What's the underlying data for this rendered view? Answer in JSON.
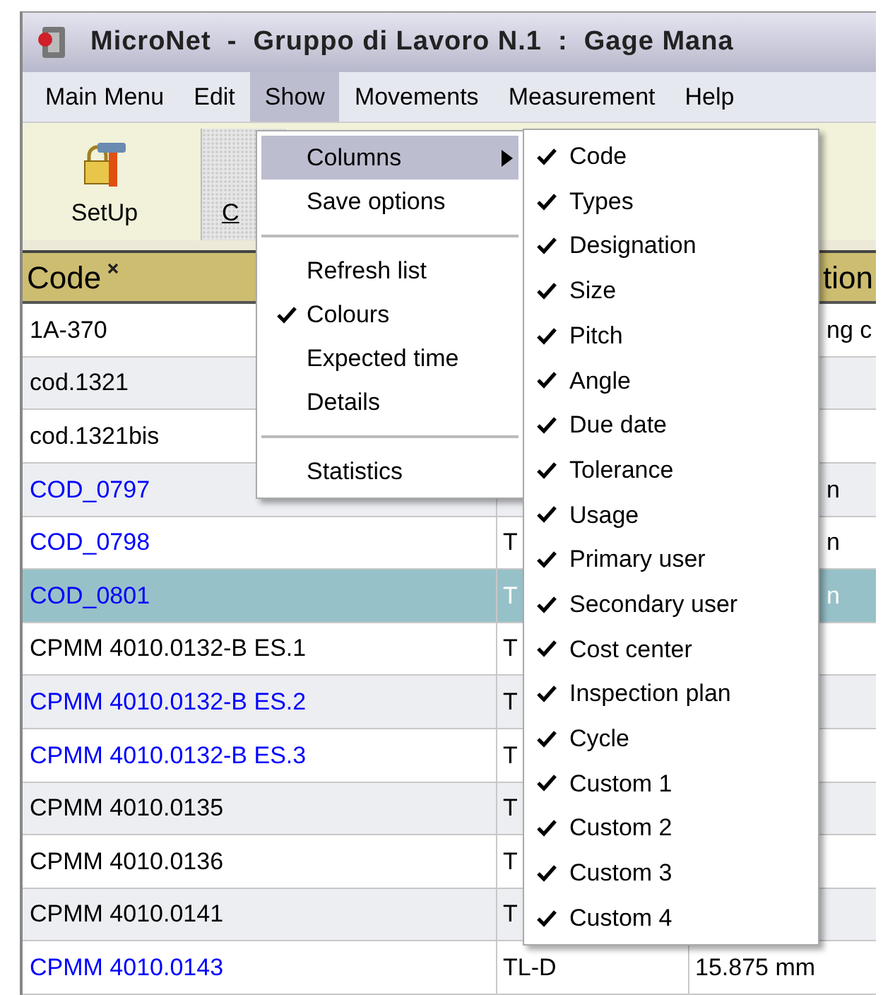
{
  "window": {
    "title": "MicroNet  -  Gruppo di Lavoro N.1  :  Gage Mana"
  },
  "menu_bar": [
    {
      "label": "Main Menu",
      "selected": false
    },
    {
      "label": "Edit",
      "selected": false
    },
    {
      "label": "Show",
      "selected": true
    },
    {
      "label": "Movements",
      "selected": false
    },
    {
      "label": "Measurement",
      "selected": false
    },
    {
      "label": "Help",
      "selected": false
    }
  ],
  "toolbar": [
    {
      "label": "SetUp",
      "kind": "setup"
    },
    {
      "label": "C",
      "kind": "partial"
    }
  ],
  "table": {
    "columns": [
      {
        "label": "Code"
      },
      {
        "label": "tion"
      }
    ],
    "rows": [
      {
        "code": "1A-370",
        "column_3": "ng c",
        "column_3_covered": true,
        "color": "#000000",
        "selected": false
      },
      {
        "code": "cod.1321",
        "color": "#000000",
        "selected": false
      },
      {
        "code": "cod.1321bis",
        "color": "#000000",
        "selected": false
      },
      {
        "code": "COD_0797",
        "column_3": "n",
        "column_3_covered": true,
        "color": "#0000ff",
        "selected": false
      },
      {
        "code": "COD_0798",
        "types": "T",
        "column_3": "n",
        "column_3_covered": true,
        "color": "#0000ff",
        "selected": false
      },
      {
        "code": "COD_0801",
        "types": "T",
        "column_3": "n",
        "column_3_covered": true,
        "color": "#0000ff",
        "selected": true
      },
      {
        "code": "CPMM 4010.0132-B ES.1",
        "types": "T",
        "color": "#000000",
        "selected": false
      },
      {
        "code": "CPMM 4010.0132-B ES.2",
        "types": "T",
        "color": "#0000ff",
        "selected": false
      },
      {
        "code": "CPMM 4010.0132-B ES.3",
        "types": "T",
        "color": "#0000ff",
        "selected": false
      },
      {
        "code": "CPMM 4010.0135",
        "types": "T",
        "color": "#000000",
        "selected": false
      },
      {
        "code": "CPMM 4010.0136",
        "types": "T",
        "color": "#000000",
        "selected": false
      },
      {
        "code": "CPMM 4010.0141",
        "types": "T",
        "color": "#000000",
        "selected": false
      },
      {
        "code": "CPMM 4010.0143",
        "types": "TL-D",
        "column_3": "15.875 mm",
        "column_3_covered": false,
        "color": "#0000ff",
        "selected": false
      }
    ]
  },
  "show_menu": {
    "items": [
      {
        "kind": "item",
        "label": "Columns",
        "submenu": true,
        "selected": true,
        "checked": false
      },
      {
        "kind": "item",
        "label": "Save options",
        "submenu": false,
        "selected": false,
        "checked": false
      },
      {
        "kind": "separator"
      },
      {
        "kind": "item",
        "label": "Refresh list",
        "submenu": false,
        "selected": false,
        "checked": false
      },
      {
        "kind": "item",
        "label": "Colours",
        "submenu": false,
        "selected": false,
        "checked": true
      },
      {
        "kind": "item",
        "label": "Expected time",
        "submenu": false,
        "selected": false,
        "checked": false
      },
      {
        "kind": "item",
        "label": "Details",
        "submenu": false,
        "selected": false,
        "checked": false
      },
      {
        "kind": "separator"
      },
      {
        "kind": "item",
        "label": "Statistics",
        "submenu": false,
        "selected": false,
        "checked": false
      }
    ]
  },
  "columns_submenu": {
    "items": [
      {
        "label": "Code",
        "checked": true
      },
      {
        "label": "Types",
        "checked": true
      },
      {
        "label": "Designation",
        "checked": true
      },
      {
        "label": "Size",
        "checked": true
      },
      {
        "label": "Pitch",
        "checked": true
      },
      {
        "label": "Angle",
        "checked": true
      },
      {
        "label": "Due date",
        "checked": true
      },
      {
        "label": "Tolerance",
        "checked": true
      },
      {
        "label": "Usage",
        "checked": true
      },
      {
        "label": "Primary user",
        "checked": true
      },
      {
        "label": "Secondary user",
        "checked": true
      },
      {
        "label": "Cost center",
        "checked": true
      },
      {
        "label": "Inspection plan",
        "checked": true
      },
      {
        "label": "Cycle",
        "checked": true
      },
      {
        "label": "Custom 1",
        "checked": true
      },
      {
        "label": "Custom 2",
        "checked": true
      },
      {
        "label": "Custom 3",
        "checked": true
      },
      {
        "label": "Custom 4",
        "checked": true
      }
    ]
  }
}
